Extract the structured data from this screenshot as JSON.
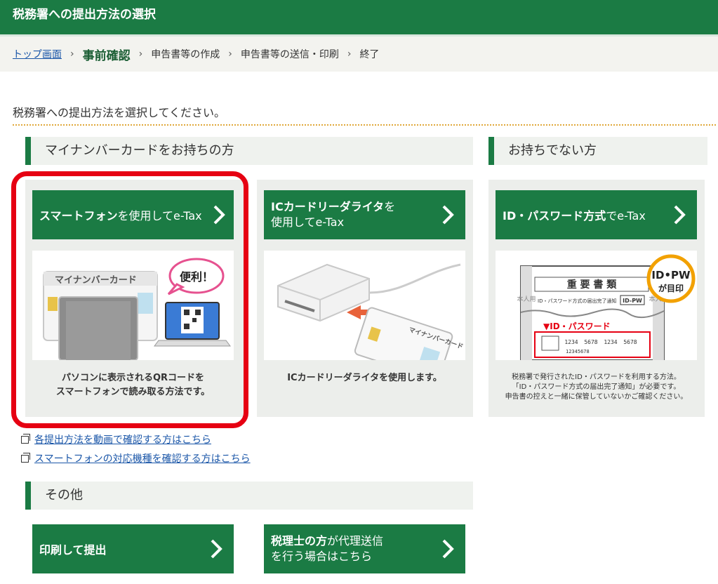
{
  "header": {
    "title": "税務署への提出方法の選択"
  },
  "breadcrumb": {
    "top": "トップ画面",
    "current": "事前確認",
    "step3": "申告書等の作成",
    "step4": "申告書等の送信・印刷",
    "step5": "終了",
    "separator": "›"
  },
  "lead": "税務署への提出方法を選択してください。",
  "section_mynumber": {
    "title": "マイナンバーカードをお持ちの方"
  },
  "section_none": {
    "title": "お持ちでない方"
  },
  "section_other": {
    "title": "その他"
  },
  "card_smartphone": {
    "bold": "スマートフォン",
    "normal": "を使用してe-Tax",
    "desc_line1": "パソコンに表示されるQRコードを",
    "desc_line2": "スマートフォンで読み取る方法です。",
    "illus_card_label": "マイナンバーカード",
    "illus_bubble": "便利！"
  },
  "card_icreader": {
    "bold": "ICカードリーダライタ",
    "normal1": "を",
    "normal2": "使用してe-Tax",
    "desc": "ICカードリーダライタを使用します。",
    "illus_card_label": "マイナンバーカード"
  },
  "card_idpw": {
    "bold": "ID・パスワード方式",
    "normal": "でe-Tax",
    "desc_line1": "税務署で発行されたID・パスワードを利用する方法。",
    "desc_line2": "「ID・パスワード方式の届出完了通知」が必要です。",
    "desc_line3": "申告書の控えと一緒に保管していないかご確認ください。",
    "illus_doc_title": "重 要 書 類",
    "illus_doc_sub": "ID・パスワード方式の届出完了通知",
    "illus_idpw_tag": "ID-PW",
    "illus_idpw_label": "▼ID・パスワード",
    "illus_badge_top": "ID•PW",
    "illus_badge_bottom": "が目印",
    "illus_num1": "1234",
    "illus_num2": "5678",
    "illus_num3": "1234",
    "illus_num4": "5678",
    "illus_num5": "12345678",
    "illus_side_left": "本人用",
    "illus_side_right": "本人用"
  },
  "links": {
    "video": "各提出方法を動画で確認する方はこちら",
    "models": "スマートフォンの対応機種を確認する方はこちら"
  },
  "btn_print": {
    "bold": "印刷して提出"
  },
  "btn_tax_accountant": {
    "bold": "税理士の方",
    "normal1": "が代理送信",
    "line2": "を行う場合はこちら"
  },
  "colors": {
    "primary": "#1b7b44",
    "highlight": "#e60012",
    "link": "#1a56a8"
  }
}
